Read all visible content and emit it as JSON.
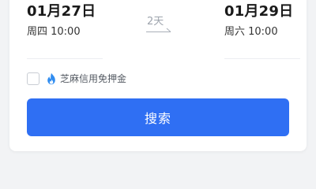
{
  "pickup": {
    "date": "01月27日",
    "day_time": "周四 10:00"
  },
  "return": {
    "date": "01月29日",
    "day_time": "周六 10:00"
  },
  "duration": {
    "label": "2天"
  },
  "deposit": {
    "checked": false,
    "icon": "flame-icon",
    "label": "芝麻信用免押金"
  },
  "search": {
    "label": "搜索"
  },
  "colors": {
    "primary": "#2f6ff3",
    "flame": "#2f8cf0",
    "text_dark": "#1a1a1a",
    "text_muted": "#9ea4ad",
    "background": "#f2f3f5"
  }
}
